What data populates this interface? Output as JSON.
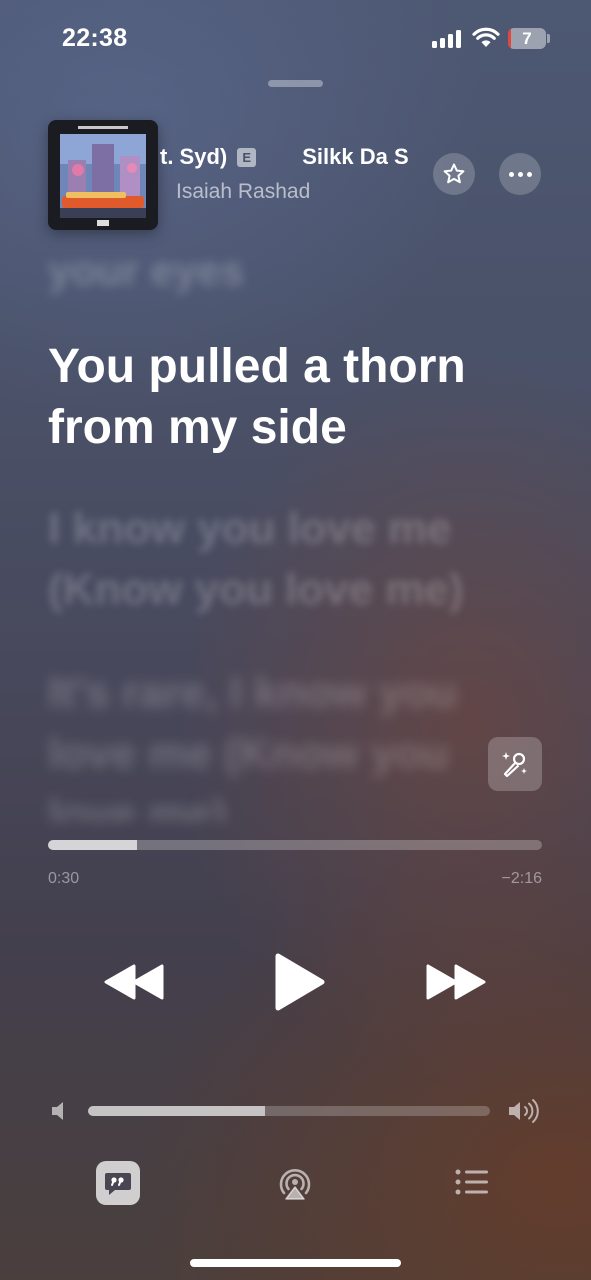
{
  "status_bar": {
    "time": "22:38",
    "battery_level": "7",
    "battery_fraction": 0.07,
    "icons": [
      "cellular-signal-icon",
      "wifi-icon",
      "battery-icon"
    ]
  },
  "now_playing": {
    "title_visible_start": "t. Syd)",
    "explicit_label": "E",
    "title_visible_next": "Silkk Da S",
    "artist": "Isaiah Rashad",
    "artwork_icon": "album-artwork"
  },
  "header_actions": {
    "favorite_icon": "star-icon",
    "more_icon": "ellipsis-icon"
  },
  "lyrics": {
    "previous": "your eyes",
    "current": "You pulled a thorn from my side",
    "next_1": "I know you love me (Know you love me)",
    "next_2": "It's rare, I know you love me (Know you love me)"
  },
  "sing_button_icon": "sparkle-microphone-icon",
  "playback": {
    "elapsed": "0:30",
    "remaining": "−2:16",
    "progress_fraction": 0.18
  },
  "transport": {
    "rewind_icon": "rewind-icon",
    "play_icon": "play-icon",
    "fast_forward_icon": "fast-forward-icon"
  },
  "volume": {
    "level_fraction": 0.44,
    "low_icon": "volume-low-icon",
    "high_icon": "volume-high-icon"
  },
  "toolbar": {
    "lyrics_icon": "lyrics-quote-icon",
    "airplay_icon": "airplay-icon",
    "queue_icon": "queue-list-icon"
  },
  "colors": {
    "battery_low": "#e5453b"
  }
}
